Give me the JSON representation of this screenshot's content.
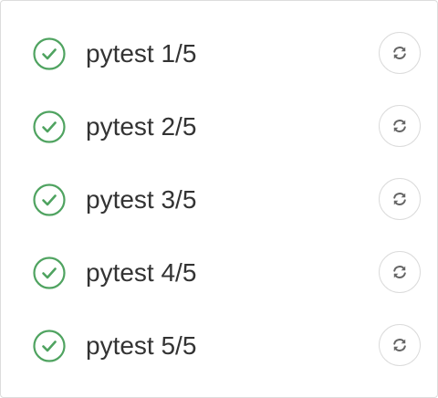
{
  "colors": {
    "success": "#4fa360",
    "icon_gray": "#666666",
    "border": "#dcdcdc"
  },
  "jobs": [
    {
      "name": "pytest 1/5",
      "status": "success",
      "status_icon": "check-circle-icon",
      "action_icon": "retry-icon"
    },
    {
      "name": "pytest 2/5",
      "status": "success",
      "status_icon": "check-circle-icon",
      "action_icon": "retry-icon"
    },
    {
      "name": "pytest 3/5",
      "status": "success",
      "status_icon": "check-circle-icon",
      "action_icon": "retry-icon"
    },
    {
      "name": "pytest 4/5",
      "status": "success",
      "status_icon": "check-circle-icon",
      "action_icon": "retry-icon"
    },
    {
      "name": "pytest 5/5",
      "status": "success",
      "status_icon": "check-circle-icon",
      "action_icon": "retry-icon"
    }
  ]
}
